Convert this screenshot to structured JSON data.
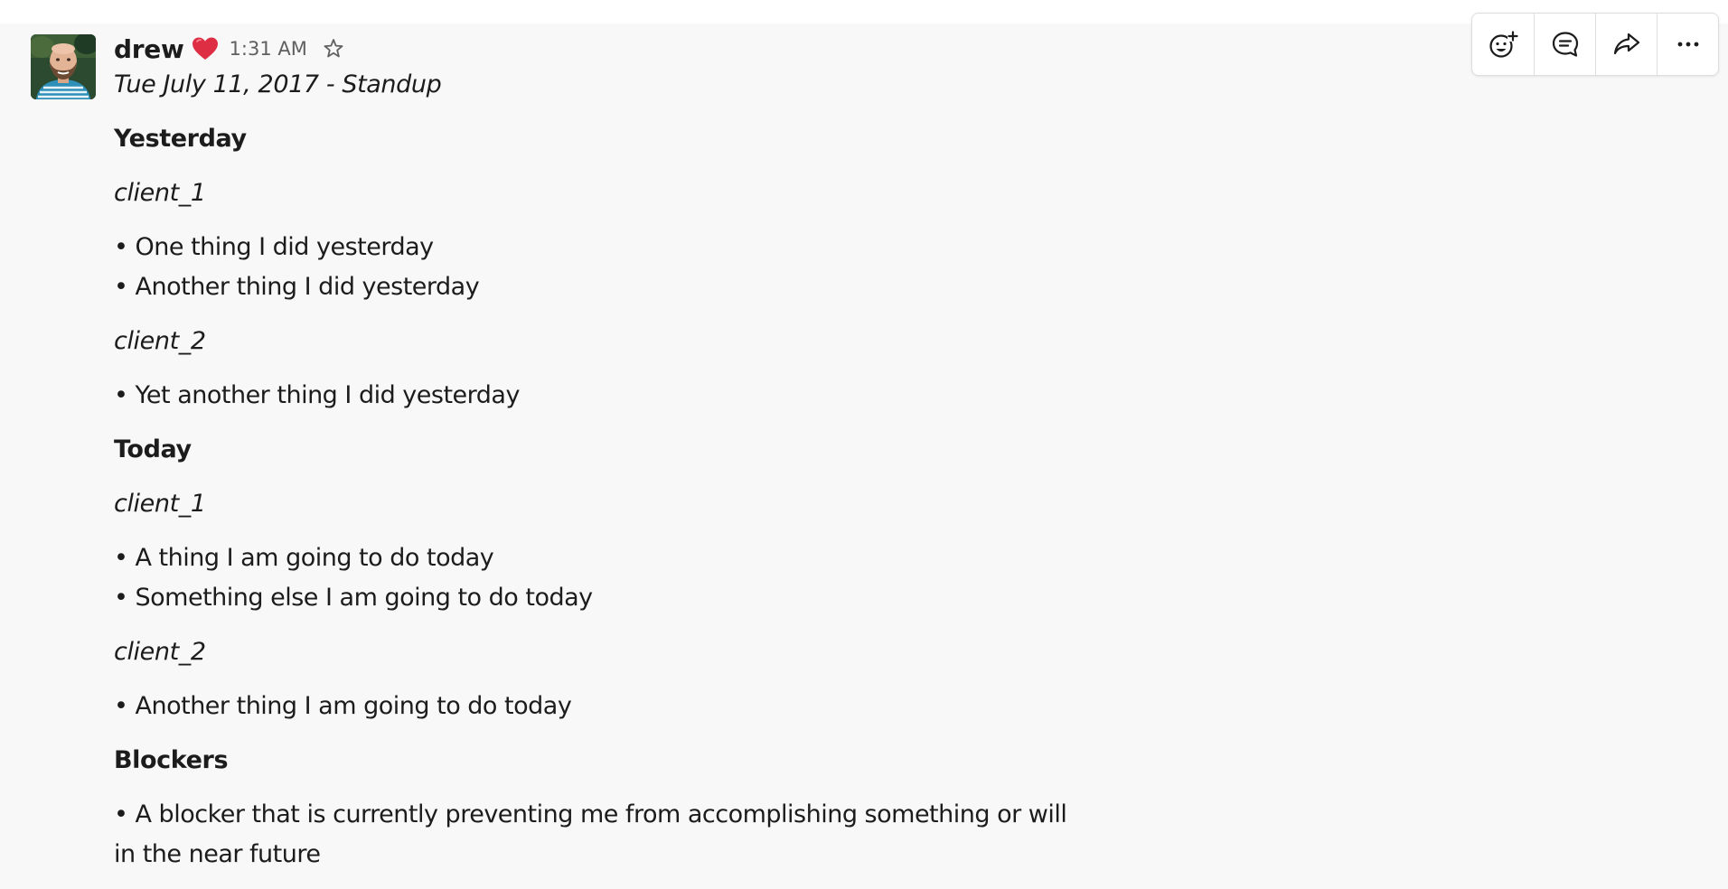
{
  "message": {
    "author": "drew",
    "author_emoji": "heart-emoji",
    "timestamp": "1:31 AM",
    "title": "Tue July 11, 2017 - Standup",
    "sections": [
      {
        "heading": "Yesterday",
        "clients": [
          {
            "name": "client_1",
            "items": [
              "• One thing I did yesterday",
              "• Another thing I did yesterday"
            ]
          },
          {
            "name": "client_2",
            "items": [
              "• Yet another thing I did yesterday"
            ]
          }
        ]
      },
      {
        "heading": "Today",
        "clients": [
          {
            "name": "client_1",
            "items": [
              "• A thing I am going to do today",
              "• Something else I am going to do today"
            ]
          },
          {
            "name": "client_2",
            "items": [
              "• Another thing I am going to do today"
            ]
          }
        ]
      },
      {
        "heading": "Blockers",
        "items": [
          "• A blocker that is currently preventing me from accomplishing something or will",
          "in the near future"
        ]
      }
    ]
  },
  "actions": [
    {
      "name": "add-reaction",
      "icon": "emoji-add-icon"
    },
    {
      "name": "start-thread",
      "icon": "comment-icon"
    },
    {
      "name": "share-message",
      "icon": "share-arrow-icon"
    },
    {
      "name": "more-actions",
      "icon": "ellipsis-icon"
    }
  ],
  "colors": {
    "message_bg": "#f8f8f8",
    "text": "#1d1c1d",
    "muted": "#616061",
    "heart": "#dd2e44"
  }
}
